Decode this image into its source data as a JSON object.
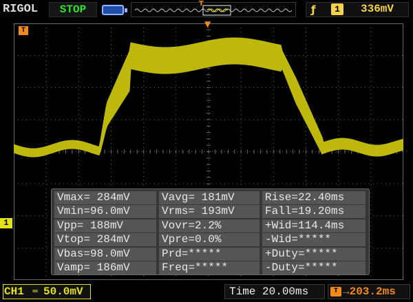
{
  "header": {
    "brand": "RIGOL",
    "run_state": "STOP",
    "trigger_marker": "T",
    "trigger_edge": "ƒ",
    "trigger_source": "1",
    "trigger_level": "336mV"
  },
  "screen": {
    "trigger_time_marker": "T",
    "channel_ground_marker": "1",
    "wave_color": "#c8c20c",
    "grid_color": "#6a6a6a"
  },
  "measurements": {
    "rows": [
      [
        "Vmax= 284mV",
        "Vavg= 181mV",
        "Rise=22.40ms"
      ],
      [
        "Vmin=96.0mV",
        "Vrms= 193mV",
        "Fall=19.20ms"
      ],
      [
        "Vpp= 188mV",
        "Vovr=2.2%",
        "+Wid=114.4ms"
      ],
      [
        "Vtop= 284mV",
        "Vpre=0.0%",
        "-Wid=*****"
      ],
      [
        "Vbas=98.0mV",
        "Prd=*****",
        "+Duty=*****"
      ],
      [
        "Vamp= 186mV",
        "Freq=*****",
        "-Duty=*****"
      ]
    ]
  },
  "footer": {
    "ch1_label": "CH1",
    "ch1_coupling": "═",
    "ch1_scale": "50.0mV",
    "timebase": "Time 20.00ms",
    "offset_icon": "T",
    "offset_value": "→203.2ms"
  }
}
